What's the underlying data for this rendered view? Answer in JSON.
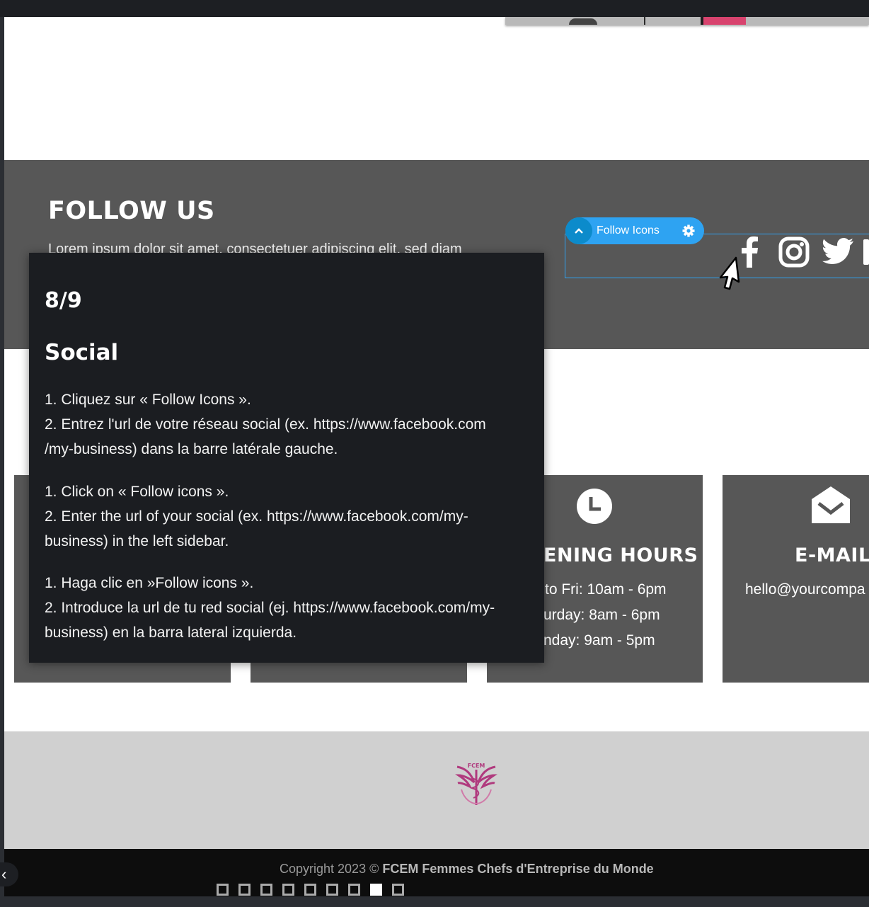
{
  "follow_section": {
    "title": "FOLLOW US",
    "text": "Lorem ipsum dolor sit amet, consectetuer adipiscing elit, sed diam"
  },
  "module": {
    "label": "Follow Icons",
    "chevron_icon": "chevron-up-icon",
    "settings_icon": "gear-icon",
    "accent_color": "#2ea3f2"
  },
  "social_icons": [
    "facebook-icon",
    "instagram-icon",
    "twitter-icon"
  ],
  "cards": {
    "hours": {
      "icon": "clock-icon",
      "title": "ENING HOURS",
      "lines": [
        "to Fri: 10am - 6pm",
        "urday: 8am - 6pm",
        "nday: 9am - 5pm"
      ]
    },
    "email": {
      "icon": "envelope-icon",
      "title": "E-MAIL",
      "lines": [
        "hello@yourcompa"
      ]
    }
  },
  "footer": {
    "logo_text": "FCEM",
    "copyright_prefix": "Copyright 2023 ©",
    "company": "FCEM Femmes Chefs d'Entreprise du Monde"
  },
  "tooltip": {
    "step": "8/9",
    "title": "Social",
    "fr_1": "1. Cliquez sur « Follow Icons ».",
    "fr_2a": "2. Entrez l'url de votre réseau social (ex. https://www.facebook.com",
    "fr_2b": "/my-business) dans la barre latérale gauche.",
    "en_1": "1. Click on « Follow icons ».",
    "en_2a": "2. Enter the url of your social (ex. https://www.facebook.com/my-",
    "en_2b": "business) in the left sidebar.",
    "es_1": "1. Haga clic en »Follow icons ».",
    "es_2a": "2. Introduce la url de tu red social (ej. https://www.facebook.com/my-",
    "es_2b": "business) en la barra lateral izquierda."
  },
  "tour": {
    "total_steps": 9,
    "current_step": 8
  },
  "colors": {
    "section_dark": "#575757",
    "tooltip_bg": "#1b1d21",
    "footer_gray": "#d0d0d0",
    "footer_black": "#0d0d0d",
    "logo_color": "#b03a7e"
  }
}
